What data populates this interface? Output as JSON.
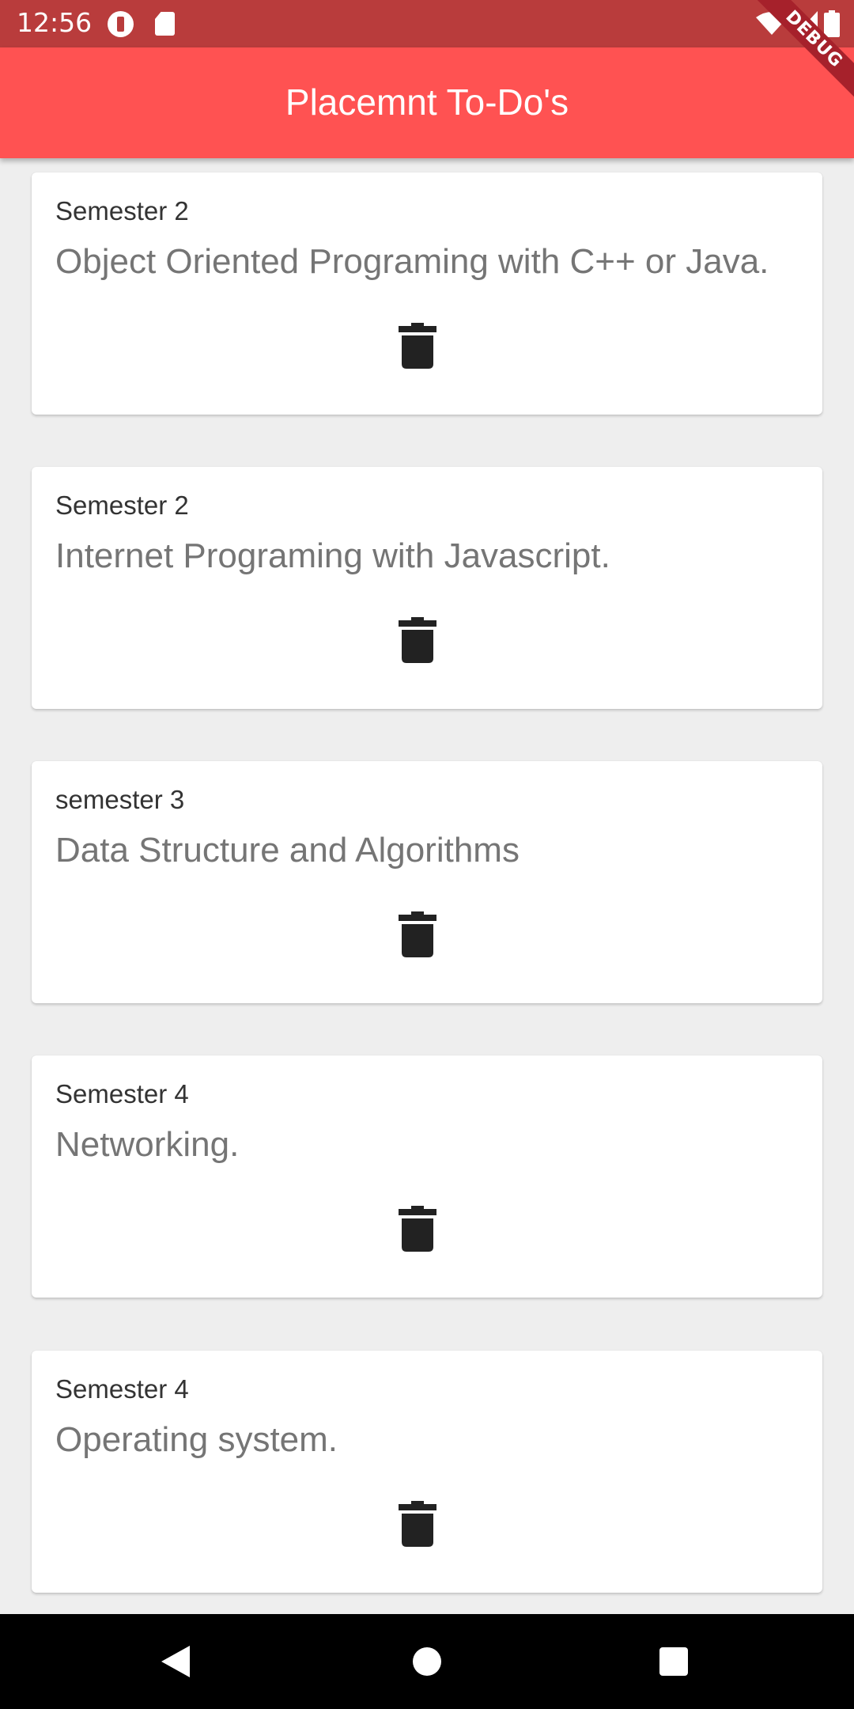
{
  "status_bar": {
    "time": "12:56",
    "icons": [
      "app-notification-icon",
      "sd-card-icon",
      "wifi-icon",
      "cell-signal-icon",
      "battery-icon"
    ]
  },
  "debug_banner": "DEBUG",
  "app_bar": {
    "title": "Placemnt To-Do's",
    "color": "#ff5252"
  },
  "todos": [
    {
      "semester": "Semester 2",
      "title": "Object Oriented Programing with C++ or Java.",
      "delete_icon": "trash-icon"
    },
    {
      "semester": "Semester 2",
      "title": "Internet Programing with Javascript.",
      "delete_icon": "trash-icon"
    },
    {
      "semester": "semester 3",
      "title": "Data Structure and Algorithms",
      "delete_icon": "trash-icon"
    },
    {
      "semester": "Semester 4",
      "title": "Networking.",
      "delete_icon": "trash-icon"
    },
    {
      "semester": "Semester 4",
      "title": "Operating system.",
      "delete_icon": "trash-icon"
    }
  ],
  "nav_bar": {
    "buttons": [
      "back-icon",
      "home-icon",
      "recent-apps-icon"
    ]
  }
}
